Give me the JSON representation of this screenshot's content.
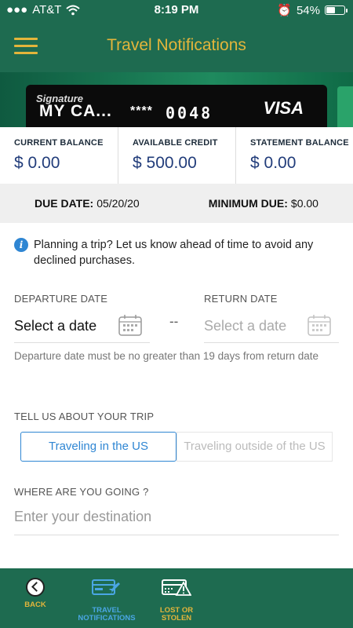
{
  "status_bar": {
    "carrier": "AT&T",
    "time": "8:19 PM",
    "battery": "54%",
    "battery_level": 0.54
  },
  "header": {
    "title": "Travel Notifications"
  },
  "card": {
    "brand_line": "Signature",
    "name": "MY CA...",
    "mask": "****",
    "last_digits": "0048",
    "network": "VISA"
  },
  "balances": [
    {
      "label": "CURRENT BALANCE",
      "value": "$ 0.00"
    },
    {
      "label": "AVAILABLE CREDIT",
      "value": "$ 500.00"
    },
    {
      "label": "STATEMENT BALANCE",
      "value": "$ 0.00"
    }
  ],
  "due": {
    "due_label": "DUE DATE:",
    "due_value": "05/20/20",
    "min_label": "MINIMUM DUE:",
    "min_value": "$0.00"
  },
  "info": {
    "text": "Planning a trip? Let us know ahead of time to avoid any declined purchases."
  },
  "form": {
    "departure_label": "DEPARTURE DATE",
    "departure_value": "Select a date",
    "separator": "--",
    "return_label": "RETURN DATE",
    "return_placeholder": "Select a date",
    "hint": "Departure date must be no greater than 19 days from return date",
    "trip_label": "TELL US ABOUT YOUR TRIP",
    "trip_options": [
      "Traveling in the US",
      "Traveling outside of the US"
    ],
    "trip_selected": "Traveling in the US",
    "destination_label": "WHERE ARE YOU GOING ?",
    "destination_placeholder": "Enter your destination"
  },
  "bottom_nav": [
    {
      "label": "BACK",
      "icon": "back-icon"
    },
    {
      "label": "TRAVEL NOTIFICATIONS",
      "icon": "travel-card-icon",
      "active": true
    },
    {
      "label": "LOST OR STOLEN",
      "icon": "lost-card-warning-icon"
    }
  ],
  "colors": {
    "brand_green": "#1e6b50",
    "gold": "#e3b53b",
    "accent_blue": "#2f86d3"
  }
}
